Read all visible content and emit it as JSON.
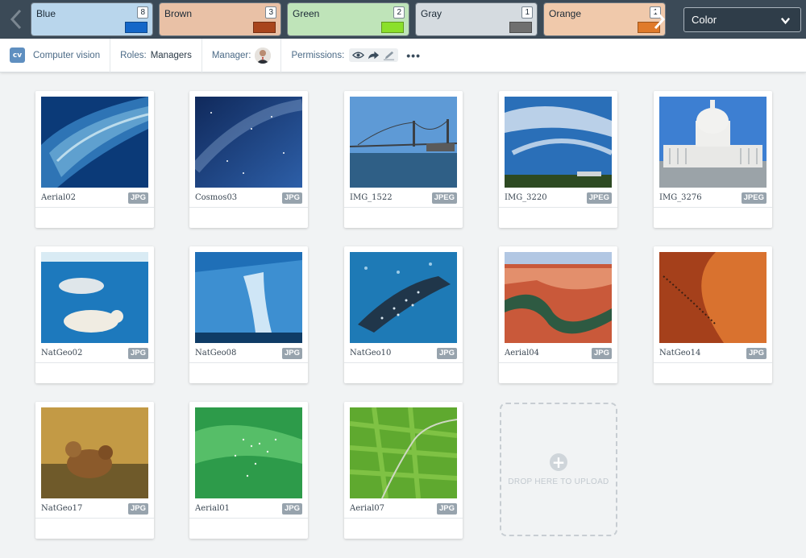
{
  "color_filters": [
    {
      "name": "Blue",
      "count": "8",
      "swatch": "#1467c8",
      "bg": "#b9d6ec"
    },
    {
      "name": "Brown",
      "count": "3",
      "swatch": "#a8451d",
      "bg": "#e9c1a6"
    },
    {
      "name": "Green",
      "count": "2",
      "swatch": "#8be02b",
      "bg": "#bfe4b9"
    },
    {
      "name": "Gray",
      "count": "1",
      "swatch": "#6f6f6f",
      "bg": "#d5dbe0"
    },
    {
      "name": "Orange",
      "count": "1",
      "swatch": "#e07a2a",
      "bg": "#f0c9ab"
    }
  ],
  "color_select": {
    "value": "Color"
  },
  "toolbar": {
    "logo": "cv",
    "title": "Computer vision",
    "roles_label": "Roles:",
    "roles_value": "Managers",
    "manager_label": "Manager:",
    "permissions_label": "Permissions:",
    "more": "•••"
  },
  "images": [
    {
      "name": "Aerial02",
      "type": "JPG",
      "art": "aerial02"
    },
    {
      "name": "Cosmos03",
      "type": "JPG",
      "art": "cosmos"
    },
    {
      "name": "IMG_1522",
      "type": "JPEG",
      "art": "bridge"
    },
    {
      "name": "IMG_3220",
      "type": "JPEG",
      "art": "sky"
    },
    {
      "name": "IMG_3276",
      "type": "JPEG",
      "art": "capitol"
    },
    {
      "name": "NatGeo02",
      "type": "JPG",
      "art": "bears"
    },
    {
      "name": "NatGeo08",
      "type": "JPG",
      "art": "glacier"
    },
    {
      "name": "NatGeo10",
      "type": "JPG",
      "art": "shark"
    },
    {
      "name": "Aerial04",
      "type": "JPG",
      "art": "canyon"
    },
    {
      "name": "NatGeo14",
      "type": "JPG",
      "art": "dune"
    },
    {
      "name": "NatGeo17",
      "type": "JPG",
      "art": "lions"
    },
    {
      "name": "Aerial01",
      "type": "JPG",
      "art": "aerial01"
    },
    {
      "name": "Aerial07",
      "type": "JPG",
      "art": "fields"
    }
  ],
  "dropzone": {
    "text": "DROP HERE TO UPLOAD"
  }
}
